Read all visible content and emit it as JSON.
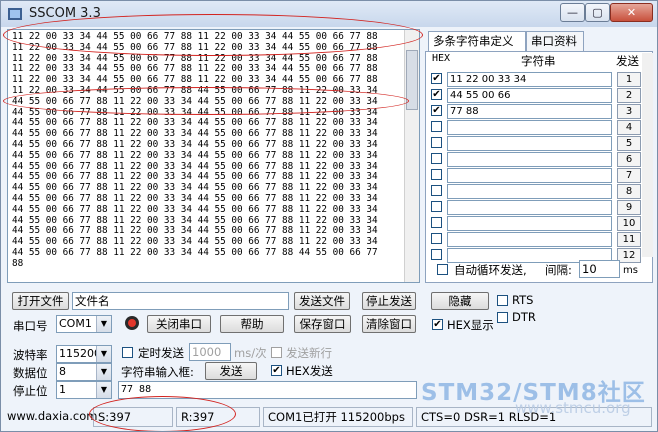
{
  "window": {
    "title": "SSCOM 3.3",
    "controls": {
      "minimize": "—",
      "maximize": "▢",
      "close": "✕"
    }
  },
  "receive": {
    "lines": [
      "11 22 00 33 34 44 55 00 66 77 88 11 22 00 33 34 44 55 00 66 77 88",
      "11 22 00 33 34 44 55 00 66 77 88 11 22 00 33 34 44 55 00 66 77 88",
      "11 22 00 33 34 44 55 00 66 77 88 11 22 00 33 34 44 55 00 66 77 88",
      "11 22 00 33 34 44 55 00 66 77 88 11 22 00 33 34 44 55 00 66 77 88",
      "11 22 00 33 34 44 55 00 66 77 88 11 22 00 33 34 44 55 00 66 77 88",
      "11 22 00 33 34 44 55 00 66 77 88 44 55 00 66 77 88 11 22 00 33 34",
      "44 55 00 66 77 88 11 22 00 33 34 44 55 00 66 77 88 11 22 00 33 34",
      "44 55 00 66 77 88 11 22 00 33 34 44 55 00 66 77 88 11 22 00 33 34",
      "44 55 00 66 77 88 11 22 00 33 34 44 55 00 66 77 88 11 22 00 33 34",
      "44 55 00 66 77 88 11 22 00 33 34 44 55 00 66 77 88 11 22 00 33 34",
      "44 55 00 66 77 88 11 22 00 33 34 44 55 00 66 77 88 11 22 00 33 34",
      "44 55 00 66 77 88 11 22 00 33 34 44 55 00 66 77 88 11 22 00 33 34",
      "44 55 00 66 77 88 11 22 00 33 34 44 55 00 66 77 88 11 22 00 33 34",
      "44 55 00 66 77 88 11 22 00 33 34 44 55 00 66 77 88 11 22 00 33 34",
      "44 55 00 66 77 88 11 22 00 33 34 44 55 00 66 77 88 11 22 00 33 34",
      "44 55 00 66 77 88 11 22 00 33 34 44 55 00 66 77 88 11 22 00 33 34",
      "44 55 00 66 77 88 11 22 00 33 34 44 55 00 66 77 88 11 22 00 33 34",
      "44 55 00 66 77 88 11 22 00 33 34 44 55 00 66 77 88 11 22 00 33 34",
      "44 55 00 66 77 88 11 22 00 33 34 44 55 00 66 77 88 11 22 00 33 34",
      "44 55 00 66 77 88 11 22 00 33 34 44 55 00 66 77 88 11 22 00 33 34",
      "44 55 00 66 77 88 11 22 00 33 34 44 55 00 66 77 88 44 55 00 66 77",
      "88"
    ]
  },
  "tabs": [
    "多条字符串定义",
    "串口资料"
  ],
  "multi_string": {
    "col_hex": "HEX",
    "col_string": "字符串",
    "col_send": "发送",
    "rows": [
      {
        "checked": true,
        "value": "11 22 00 33 34",
        "n": "1"
      },
      {
        "checked": true,
        "value": "44 55 00 66",
        "n": "2"
      },
      {
        "checked": true,
        "value": "77 88",
        "n": "3"
      },
      {
        "checked": false,
        "value": "",
        "n": "4"
      },
      {
        "checked": false,
        "value": "",
        "n": "5"
      },
      {
        "checked": false,
        "value": "",
        "n": "6"
      },
      {
        "checked": false,
        "value": "",
        "n": "7"
      },
      {
        "checked": false,
        "value": "",
        "n": "8"
      },
      {
        "checked": false,
        "value": "",
        "n": "9"
      },
      {
        "checked": false,
        "value": "",
        "n": "10"
      },
      {
        "checked": false,
        "value": "",
        "n": "11"
      },
      {
        "checked": false,
        "value": "",
        "n": "12"
      }
    ],
    "auto_loop_label": "自动循环发送,",
    "interval_label": "间隔:",
    "interval_value": "10",
    "interval_unit": "ms"
  },
  "toolbar": {
    "open_file": "打开文件",
    "file_name": "文件名",
    "send_file": "发送文件",
    "stop_send": "停止发送",
    "hide": "隐藏",
    "rts": "RTS",
    "dtr": "DTR",
    "port_label": "串口号",
    "port_value": "COM1",
    "close_port": "关闭串口",
    "help": "帮助",
    "save_window": "保存窗口",
    "clear_window": "清除窗口",
    "hex_display": "HEX显示"
  },
  "settings": {
    "baud_label": "波特率",
    "baud_value": "115200",
    "data_bits_label": "数据位",
    "data_bits_value": "8",
    "stop_bits_label": "停止位",
    "stop_bits_value": "1",
    "timed_send": "定时发送",
    "timed_value": "1000",
    "timed_unit": "ms/次",
    "send_newline": "发送新行",
    "input_label": "字符串输入框:",
    "send_button": "发送",
    "hex_send": "HEX发送",
    "input_value": "77 88"
  },
  "status": {
    "website": "www.daxia.com",
    "sent": "S:397",
    "received": "R:397",
    "port_state": "COM1已打开  115200bps",
    "signals": "CTS=0 DSR=1 RLSD=1"
  },
  "watermark": {
    "text": "STM32/STM8社区",
    "url": "www.stmcu.org"
  },
  "colors": {
    "annotation": "#d2231f",
    "window_bg": "#eef3fa",
    "watermark": "#8fb6e4"
  }
}
